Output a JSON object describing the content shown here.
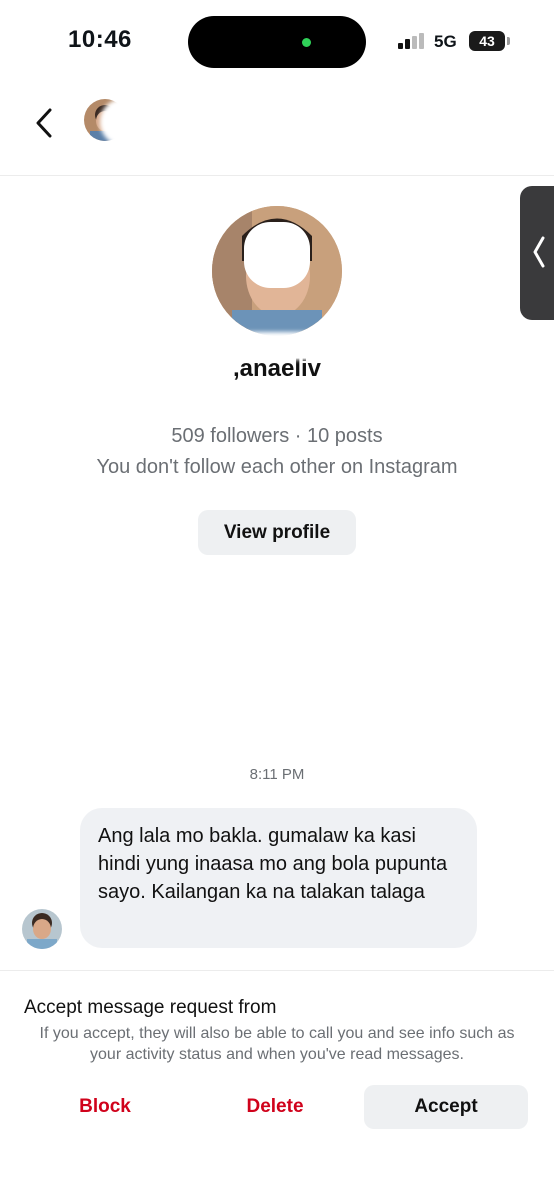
{
  "status_bar": {
    "time": "10:46",
    "network": "5G",
    "battery": "43"
  },
  "header": {
    "name": "",
    "subtitle": ""
  },
  "profile": {
    "username": ",anaeliv",
    "stats": "509 followers · 10 posts",
    "follow_status": "You don't follow each other on Instagram",
    "view_profile_label": "View profile"
  },
  "chat": {
    "timestamp": "8:11 PM",
    "messages": [
      {
        "text": "Ang lala mo bakla. gumalaw ka kasi hindi yung inaasa mo ang bola pupunta sayo. Kailangan ka na talakan talaga"
      }
    ]
  },
  "request": {
    "title": "Accept message request from",
    "description": "If you accept, they will also be able to call you and see info such as your activity status and when you've read messages.",
    "block_label": "Block",
    "delete_label": "Delete",
    "accept_label": "Accept"
  },
  "icons": {
    "back": "chevron-left-icon",
    "side_tab": "chevron-left-icon"
  },
  "colors": {
    "destructive": "#d0021b",
    "bubble": "#eff1f4",
    "secondary_text": "#6b6f74",
    "button_bg": "#eef0f2"
  }
}
